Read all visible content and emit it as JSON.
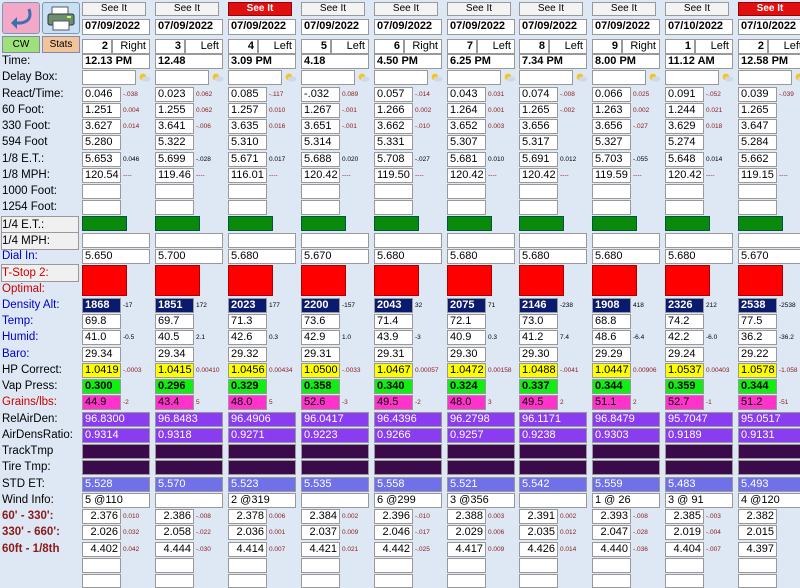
{
  "toolbar": {
    "cw_label": "CW",
    "stats_label": "Stats"
  },
  "colors": {
    "background": "#dde8f4",
    "green_bar": "#0a8a0a",
    "red_bar": "#ff0000",
    "navy": "#0a1a6e",
    "yellow": "#ffff00",
    "lime": "#11ee11",
    "pink": "#ff33cc",
    "violet": "#8a3cf0",
    "dark_purple": "#3a0a4a",
    "periwinkle": "#7070e8",
    "see_it_red": "#e01010"
  },
  "labels": [
    {
      "text": "Time:"
    },
    {
      "text": "Delay Box:"
    },
    {
      "text": "React/Time:"
    },
    {
      "text": "60 Foot:"
    },
    {
      "text": "330 Foot:"
    },
    {
      "text": "594 Foot"
    },
    {
      "text": "1/8 E.T.:"
    },
    {
      "text": "1/8 MPH:"
    },
    {
      "text": "1000 Foot:"
    },
    {
      "text": "1254 Foot:"
    },
    {
      "text": "1/4 E.T.:",
      "box": true
    },
    {
      "text": "1/4 MPH:",
      "box": true
    },
    {
      "text": "Dial In:",
      "color": "#0000cc"
    },
    {
      "text": "T-Stop 2:",
      "color": "#cc0000",
      "box": true
    },
    {
      "text": "Optimal:",
      "color": "#cc0000"
    },
    {
      "text": "Density Alt:",
      "color": "#0000cc"
    },
    {
      "text": "Temp:",
      "color": "#0000cc"
    },
    {
      "text": "Humid:",
      "color": "#0000cc"
    },
    {
      "text": "Baro:",
      "color": "#0000cc"
    },
    {
      "text": "HP Correct:"
    },
    {
      "text": "Vap Press:"
    },
    {
      "text": "Grains/lbs:",
      "color": "#cc0000"
    },
    {
      "text": "RelAirDen:"
    },
    {
      "text": "AirDensRatio:"
    },
    {
      "text": "TrackTmp"
    },
    {
      "text": "Tire Tmp:"
    },
    {
      "text": "STD ET:"
    },
    {
      "text": "Wind Info:"
    },
    {
      "text": "60' - 330':",
      "color": "#8b1a1a",
      "bold": true
    },
    {
      "text": "330' - 660':",
      "color": "#8b1a1a",
      "bold": true
    },
    {
      "text": "60ft - 1/8th",
      "color": "#8b1a1a",
      "bold": true
    }
  ],
  "runs": [
    {
      "see_it": "See It",
      "see_it_red": false,
      "date": "07/09/2022",
      "num": "2",
      "lane": "Right",
      "time": "12.13 PM",
      "rt": "0.046",
      "rt_d": "-.038",
      "sixty": "1.251",
      "sixty_d": "0.004",
      "f330": "3.627",
      "f330_d": "0.014",
      "f594": "5.280",
      "et8": "5.653",
      "et8_d": "0.046",
      "mph8": "120.54",
      "mph8_d": "----",
      "dial": "5.650",
      "da": "1868",
      "da_d": "-17",
      "temp": "69.8",
      "humid": "41.0",
      "humid_d": "-0.5",
      "baro": "29.34",
      "hp": "1.0419",
      "hp_d": "-.0003",
      "vap": "0.300",
      "grains": "44.9",
      "grains_d": "-2",
      "rad": "96.8300",
      "adr": "0.9314",
      "std": "5.528",
      "wind": "5 @110",
      "s1": "2.376",
      "s1_d": "0.010",
      "s2": "2.026",
      "s2_d": "0.032",
      "s3": "4.402",
      "s3_d": "0.042"
    },
    {
      "see_it": "See It",
      "see_it_red": false,
      "date": "07/09/2022",
      "num": "3",
      "lane": "Left",
      "time": "12.48",
      "rt": "0.023",
      "rt_d": "0.062",
      "sixty": "1.255",
      "sixty_d": "0.062",
      "f330": "3.641",
      "f330_d": "-.006",
      "f594": "5.322",
      "et8": "5.699",
      "et8_d": "-.028",
      "mph8": "119.46",
      "mph8_d": "----",
      "dial": "5.700",
      "da": "1851",
      "da_d": "172",
      "temp": "69.7",
      "humid": "40.5",
      "humid_d": "2.1",
      "baro": "29.34",
      "hp": "1.0415",
      "hp_d": "0.00410",
      "vap": "0.296",
      "grains": "43.4",
      "grains_d": "5",
      "rad": "96.8483",
      "adr": "0.9318",
      "std": "5.570",
      "wind": "",
      "s1": "2.386",
      "s1_d": "-.008",
      "s2": "2.058",
      "s2_d": "-.022",
      "s3": "4.444",
      "s3_d": "-.030"
    },
    {
      "see_it": "See It",
      "see_it_red": true,
      "date": "07/09/2022",
      "num": "4",
      "lane": "Left",
      "time": "3.09 PM",
      "rt": "0.085",
      "rt_d": "-.117",
      "sixty": "1.257",
      "sixty_d": "0.010",
      "f330": "3.635",
      "f330_d": "0.016",
      "f594": "5.310",
      "et8": "5.671",
      "et8_d": "0.017",
      "mph8": "116.01",
      "mph8_d": "----",
      "dial": "5.680",
      "da": "2023",
      "da_d": "177",
      "temp": "71.3",
      "humid": "42.6",
      "humid_d": "0.3",
      "baro": "29.32",
      "hp": "1.0456",
      "hp_d": "0.00434",
      "vap": "0.329",
      "grains": "48.0",
      "grains_d": "5",
      "rad": "96.4906",
      "adr": "0.9271",
      "std": "5.523",
      "wind": "2 @319",
      "s1": "2.378",
      "s1_d": "0.006",
      "s2": "2.036",
      "s2_d": "0.001",
      "s3": "4.414",
      "s3_d": "0.007"
    },
    {
      "see_it": "See It",
      "see_it_red": false,
      "date": "07/09/2022",
      "num": "5",
      "lane": "Left",
      "time": "4.18",
      "rt": "-.032",
      "rt_d": "0.089",
      "sixty": "1.267",
      "sixty_d": "-.001",
      "f330": "3.651",
      "f330_d": "-.001",
      "f594": "5.314",
      "et8": "5.688",
      "et8_d": "0.020",
      "mph8": "120.42",
      "mph8_d": "----",
      "dial": "5.670",
      "da": "2200",
      "da_d": "-157",
      "temp": "73.6",
      "humid": "42.9",
      "humid_d": "1.0",
      "baro": "29.31",
      "hp": "1.0500",
      "hp_d": "-.0033",
      "vap": "0.358",
      "grains": "52.6",
      "grains_d": "-3",
      "rad": "96.0417",
      "adr": "0.9223",
      "std": "5.535",
      "wind": "",
      "s1": "2.384",
      "s1_d": "0.002",
      "s2": "2.037",
      "s2_d": "0.009",
      "s3": "4.421",
      "s3_d": "0.021"
    },
    {
      "see_it": "See It",
      "see_it_red": false,
      "date": "07/09/2022",
      "num": "6",
      "lane": "Right",
      "time": "4.50 PM",
      "rt": "0.057",
      "rt_d": "-.014",
      "sixty": "1.266",
      "sixty_d": "0.002",
      "f330": "3.662",
      "f330_d": "-.010",
      "f594": "5.331",
      "et8": "5.708",
      "et8_d": "-.027",
      "mph8": "119.50",
      "mph8_d": "----",
      "dial": "5.680",
      "da": "2043",
      "da_d": "32",
      "temp": "71.4",
      "humid": "43.9",
      "humid_d": "-3",
      "baro": "29.31",
      "hp": "1.0467",
      "hp_d": "0.00057",
      "vap": "0.340",
      "grains": "49.5",
      "grains_d": "-2",
      "rad": "96.4396",
      "adr": "0.9266",
      "std": "5.558",
      "wind": "6 @299",
      "s1": "2.396",
      "s1_d": "-.010",
      "s2": "2.046",
      "s2_d": "-.017",
      "s3": "4.442",
      "s3_d": "-.025"
    },
    {
      "see_it": "See It",
      "see_it_red": false,
      "date": "07/09/2022",
      "num": "7",
      "lane": "Left",
      "time": "6.25 PM",
      "rt": "0.043",
      "rt_d": "0.031",
      "sixty": "1.264",
      "sixty_d": "0.001",
      "f330": "3.652",
      "f330_d": "0.003",
      "f594": "5.307",
      "et8": "5.681",
      "et8_d": "0.010",
      "mph8": "120.42",
      "mph8_d": "----",
      "dial": "5.680",
      "da": "2075",
      "da_d": "71",
      "temp": "72.1",
      "humid": "40.9",
      "humid_d": "0.3",
      "baro": "29.30",
      "hp": "1.0472",
      "hp_d": "0.00158",
      "vap": "0.324",
      "grains": "48.0",
      "grains_d": "3",
      "rad": "96.2798",
      "adr": "0.9257",
      "std": "5.521",
      "wind": "3 @356",
      "s1": "2.388",
      "s1_d": "0.003",
      "s2": "2.029",
      "s2_d": "0.006",
      "s3": "4.417",
      "s3_d": "0.009"
    },
    {
      "see_it": "See It",
      "see_it_red": false,
      "date": "07/09/2022",
      "num": "8",
      "lane": "Left",
      "time": "7.34 PM",
      "rt": "0.074",
      "rt_d": "-.008",
      "sixty": "1.265",
      "sixty_d": "-.002",
      "f330": "3.656",
      "f330_d": "",
      "f594": "5.317",
      "et8": "5.691",
      "et8_d": "0.012",
      "mph8": "120.42",
      "mph8_d": "----",
      "dial": "5.680",
      "da": "2146",
      "da_d": "-238",
      "temp": "73.0",
      "humid": "41.2",
      "humid_d": "7.4",
      "baro": "29.30",
      "hp": "1.0488",
      "hp_d": "-.0041",
      "vap": "0.337",
      "grains": "49.5",
      "grains_d": "2",
      "rad": "96.1171",
      "adr": "0.9238",
      "std": "5.542",
      "wind": "",
      "s1": "2.391",
      "s1_d": "0.002",
      "s2": "2.035",
      "s2_d": "0.012",
      "s3": "4.426",
      "s3_d": "0.014"
    },
    {
      "see_it": "See It",
      "see_it_red": false,
      "date": "07/09/2022",
      "num": "9",
      "lane": "Right",
      "time": "8.00 PM",
      "rt": "0.066",
      "rt_d": "0.025",
      "sixty": "1.263",
      "sixty_d": "0.002",
      "f330": "3.656",
      "f330_d": "-.027",
      "f594": "5.327",
      "et8": "5.703",
      "et8_d": "-.055",
      "mph8": "119.59",
      "mph8_d": "----",
      "dial": "5.680",
      "da": "1908",
      "da_d": "418",
      "temp": "68.8",
      "humid": "48.6",
      "humid_d": "-6.4",
      "baro": "29.29",
      "hp": "1.0447",
      "hp_d": "0.00906",
      "vap": "0.344",
      "grains": "51.1",
      "grains_d": "2",
      "rad": "96.8479",
      "adr": "0.9303",
      "std": "5.559",
      "wind": "1 @ 26",
      "s1": "2.393",
      "s1_d": "-.008",
      "s2": "2.047",
      "s2_d": "-.028",
      "s3": "4.440",
      "s3_d": "-.036"
    },
    {
      "see_it": "See It",
      "see_it_red": false,
      "date": "07/10/2022",
      "num": "1",
      "lane": "Left",
      "time": "11.12 AM",
      "rt": "0.091",
      "rt_d": "-.052",
      "sixty": "1.244",
      "sixty_d": "0.021",
      "f330": "3.629",
      "f330_d": "0.018",
      "f594": "5.274",
      "et8": "5.648",
      "et8_d": "0.014",
      "mph8": "120.42",
      "mph8_d": "----",
      "dial": "5.680",
      "da": "2326",
      "da_d": "212",
      "temp": "74.2",
      "humid": "42.2",
      "humid_d": "-6.0",
      "baro": "29.24",
      "hp": "1.0537",
      "hp_d": "0.00403",
      "vap": "0.359",
      "grains": "52.7",
      "grains_d": "-1",
      "rad": "95.7047",
      "adr": "0.9189",
      "std": "5.483",
      "wind": "3 @ 91",
      "s1": "2.385",
      "s1_d": "-.003",
      "s2": "2.019",
      "s2_d": "-.004",
      "s3": "4.404",
      "s3_d": "-.007"
    },
    {
      "see_it": "See It",
      "see_it_red": true,
      "date": "07/10/2022",
      "num": "2",
      "lane": "Left",
      "time": "12.58 PM",
      "rt": "0.039",
      "rt_d": "-.039",
      "sixty": "1.265",
      "sixty_d": "",
      "f330": "3.647",
      "f330_d": "",
      "f594": "5.284",
      "et8": "5.662",
      "et8_d": "",
      "mph8": "119.15",
      "mph8_d": "----",
      "dial": "5.670",
      "da": "2538",
      "da_d": "-2538",
      "temp": "77.5",
      "humid": "36.2",
      "humid_d": "-36.2",
      "baro": "29.22",
      "hp": "1.0578",
      "hp_d": "-1.058",
      "vap": "0.344",
      "grains": "51.2",
      "grains_d": "-51",
      "rad": "95.0517",
      "adr": "0.9131",
      "std": "5.493",
      "wind": "4 @120",
      "s1": "2.382",
      "s1_d": "",
      "s2": "2.015",
      "s2_d": "",
      "s3": "4.397",
      "s3_d": ""
    }
  ]
}
